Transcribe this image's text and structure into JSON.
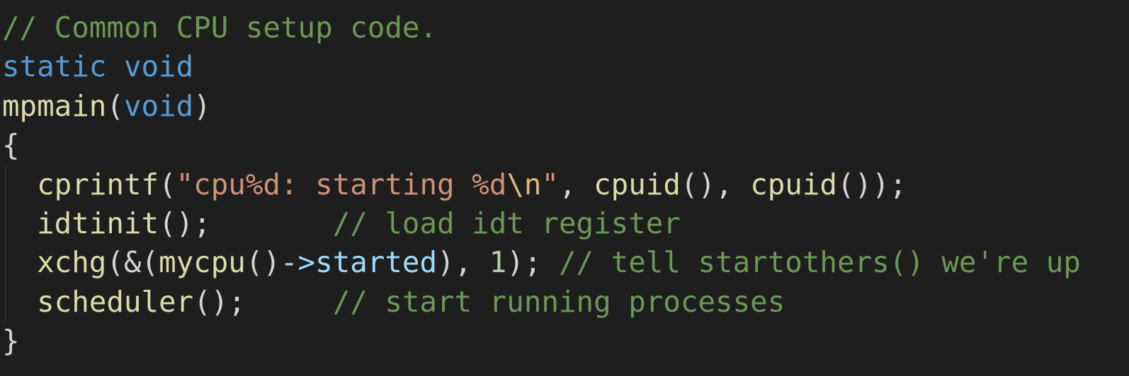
{
  "colors": {
    "background": "#1e1e1e",
    "comment": "#6a9955",
    "keyword": "#569cd6",
    "function": "#dcdcaa",
    "string": "#ce9178",
    "escape": "#d7ba7d",
    "punct": "#d4d4d4",
    "number": "#b5cea8",
    "variable": "#9cdcfe"
  },
  "lines": [
    {
      "indent_guide": false,
      "tokens": [
        [
          "comment",
          "// Common CPU setup code."
        ]
      ]
    },
    {
      "indent_guide": false,
      "tokens": [
        [
          "keyword",
          "static"
        ],
        [
          "punct",
          " "
        ],
        [
          "keyword",
          "void"
        ]
      ]
    },
    {
      "indent_guide": false,
      "tokens": [
        [
          "function",
          "mpmain"
        ],
        [
          "punct",
          "("
        ],
        [
          "keyword",
          "void"
        ],
        [
          "punct",
          ")"
        ]
      ]
    },
    {
      "indent_guide": false,
      "tokens": [
        [
          "punct",
          "{"
        ]
      ]
    },
    {
      "indent_guide": true,
      "tokens": [
        [
          "punct",
          "  "
        ],
        [
          "function",
          "cprintf"
        ],
        [
          "punct",
          "("
        ],
        [
          "string",
          "\"cpu%d: starting %d"
        ],
        [
          "escape",
          "\\n"
        ],
        [
          "string",
          "\""
        ],
        [
          "punct",
          ", "
        ],
        [
          "function",
          "cpuid"
        ],
        [
          "punct",
          "(), "
        ],
        [
          "function",
          "cpuid"
        ],
        [
          "punct",
          "());"
        ]
      ]
    },
    {
      "indent_guide": true,
      "tokens": [
        [
          "punct",
          "  "
        ],
        [
          "function",
          "idtinit"
        ],
        [
          "punct",
          "();       "
        ],
        [
          "comment",
          "// load idt register"
        ]
      ]
    },
    {
      "indent_guide": true,
      "tokens": [
        [
          "punct",
          "  "
        ],
        [
          "function",
          "xchg"
        ],
        [
          "punct",
          "(&("
        ],
        [
          "function",
          "mycpu"
        ],
        [
          "punct",
          "()"
        ],
        [
          "variable",
          "->started"
        ],
        [
          "punct",
          "), "
        ],
        [
          "number",
          "1"
        ],
        [
          "punct",
          "); "
        ],
        [
          "comment",
          "// tell startothers() we're up"
        ]
      ]
    },
    {
      "indent_guide": true,
      "tokens": [
        [
          "punct",
          "  "
        ],
        [
          "function",
          "scheduler"
        ],
        [
          "punct",
          "();     "
        ],
        [
          "comment",
          "// start running processes"
        ]
      ]
    },
    {
      "indent_guide": false,
      "tokens": [
        [
          "punct",
          "}"
        ]
      ]
    }
  ]
}
